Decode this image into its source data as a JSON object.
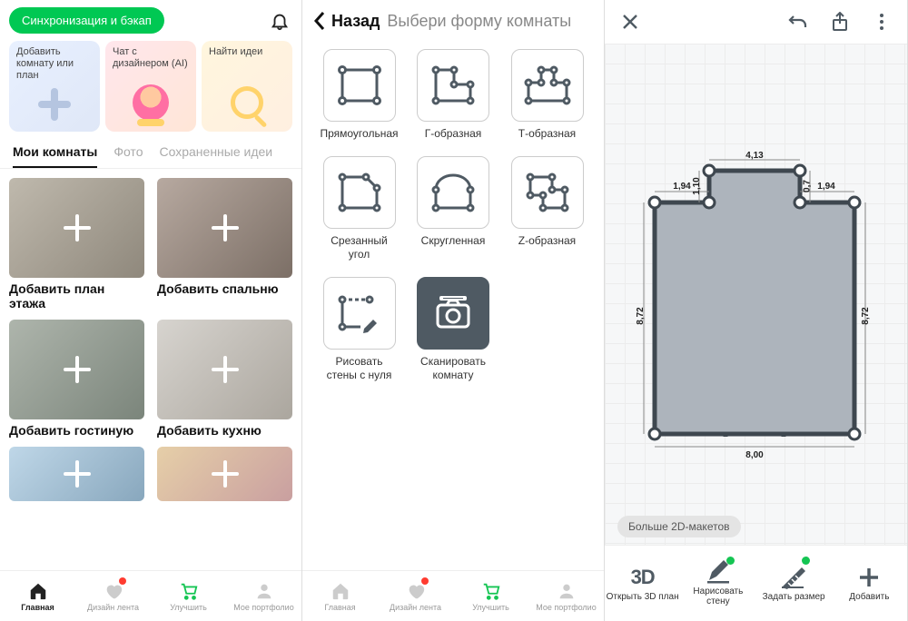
{
  "p1": {
    "sync_btn": "Синхронизация и бэкап",
    "card_add": "Добавить комнату или план",
    "card_ai": "Чат с дизайнером (AI)",
    "card_ideas": "Найти идеи",
    "tabs": {
      "rooms": "Мои комнаты",
      "photo": "Фото",
      "saved": "Сохраненные идеи"
    },
    "tiles": {
      "floor": "Добавить план этажа",
      "bedroom": "Добавить спальню",
      "living": "Добавить гостиную",
      "kitchen": "Добавить кухню"
    },
    "nav": {
      "home": "Главная",
      "feed": "Дизайн лента",
      "upgrade": "Улучшить",
      "portfolio": "Мое портфолио"
    }
  },
  "p2": {
    "back": "Назад",
    "prompt": "Выбери форму комнаты",
    "shapes": {
      "rect": "Прямоугольная",
      "l": "Г-образная",
      "t": "Т-образная",
      "cut": "Срезанный угол",
      "round": "Скругленная",
      "z": "Z-образная",
      "draw": "Рисовать стены с нуля",
      "scan": "Сканировать комнату"
    },
    "nav": {
      "home": "Главная",
      "feed": "Дизайн лента",
      "upgrade": "Улучшить",
      "portfolio": "Мое портфолио"
    }
  },
  "p3": {
    "dims": {
      "top_total": "4,13",
      "notch_left": "1,94",
      "notch_right": "1,94",
      "notch_left_v": "1,10",
      "notch_right_v": "0,7",
      "left_v": "8,72",
      "right_v": "8,72",
      "bottom": "8,00"
    },
    "more": "Больше 2D-макетов",
    "tools": {
      "open3d": "Открыть 3D план",
      "draw_wall": "Нарисовать стену",
      "set_dim": "Задать размер",
      "add": "Добавить"
    }
  }
}
